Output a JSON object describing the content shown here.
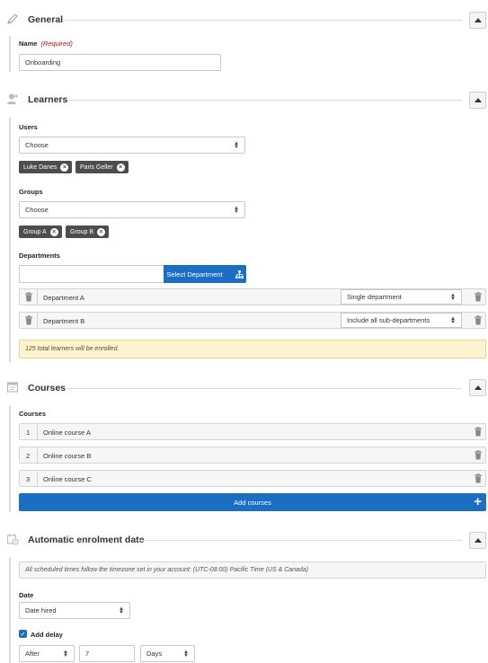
{
  "general": {
    "title": "General",
    "name_label": "Name",
    "name_required": "(Required)",
    "name_value": "Onboarding"
  },
  "learners": {
    "title": "Learners",
    "users_label": "Users",
    "users_select": "Choose",
    "users": [
      "Luke Danes",
      "Paris Geller"
    ],
    "groups_label": "Groups",
    "groups_select": "Choose",
    "groups": [
      "Group A",
      "Group B"
    ],
    "departments_label": "Departments",
    "department_input": "",
    "select_department_label": "Select Department",
    "departments": [
      {
        "name": "Department A",
        "scope": "Single department"
      },
      {
        "name": "Department B",
        "scope": "Include all sub-departments"
      }
    ],
    "notice": "125 total learners will be enrolled."
  },
  "courses": {
    "title": "Courses",
    "label": "Courses",
    "items": [
      {
        "index": "1",
        "name": "Online course A"
      },
      {
        "index": "2",
        "name": "Online course B"
      },
      {
        "index": "3",
        "name": "Online course C"
      }
    ],
    "add_label": "Add courses"
  },
  "enrolment": {
    "title": "Automatic enrolment date",
    "timezone_info": "All scheduled times follow the timezone set in your account: (UTC-08:00) Pacific Time (US & Canada)",
    "date_label": "Date",
    "date_value": "Date hired",
    "add_delay_label": "Add delay",
    "add_delay_checked": true,
    "delay_direction": "After",
    "delay_amount": "7",
    "delay_unit": "Days"
  },
  "colors": {
    "primary": "#1a6fc4",
    "chip": "#4d4d4d",
    "notice_bg": "#fdf4cf",
    "required": "#d0021b"
  }
}
